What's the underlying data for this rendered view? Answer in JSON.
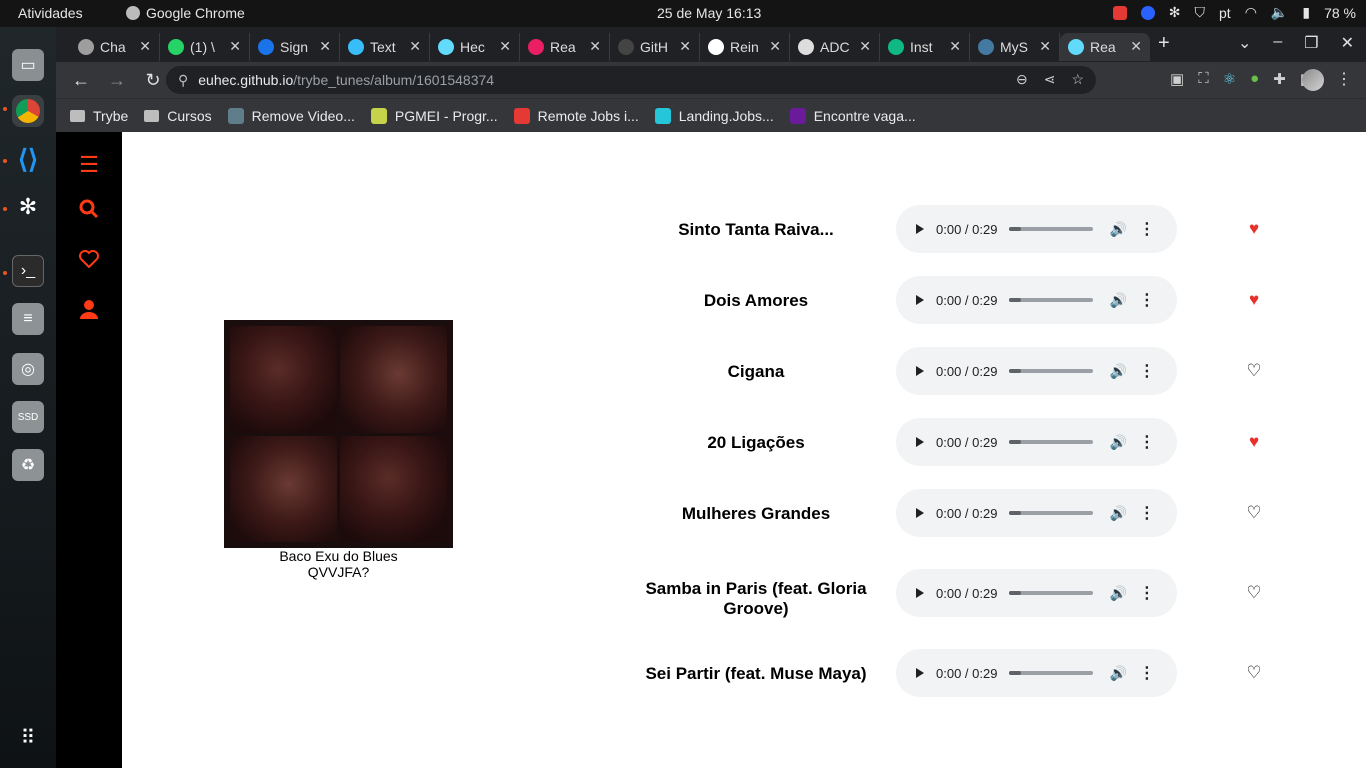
{
  "system": {
    "activities": "Atividades",
    "app_name": "Google Chrome",
    "datetime": "25 de May  16:13",
    "lang": "pt",
    "battery": "78 %"
  },
  "tabs": [
    {
      "title": "Cha",
      "color": "#9e9e9e"
    },
    {
      "title": "(1) \\",
      "color": "#25d366"
    },
    {
      "title": "Sign",
      "color": "#1a73e8"
    },
    {
      "title": "Text",
      "color": "#38bdf8"
    },
    {
      "title": "Hec",
      "color": "#61dafb"
    },
    {
      "title": "Rea",
      "color": "#e91e63"
    },
    {
      "title": "GitH",
      "color": "#444444"
    },
    {
      "title": "Rein",
      "color": "#ffffff"
    },
    {
      "title": "ADC",
      "color": "#dddddd"
    },
    {
      "title": "Inst",
      "color": "#10b981"
    },
    {
      "title": "MyS",
      "color": "#4479a1"
    },
    {
      "title": "Rea",
      "color": "#61dafb",
      "active": true
    }
  ],
  "url": {
    "host": "euhec.github.io",
    "path": "/trybe_tunes/album/1601548374"
  },
  "bookmarks": [
    {
      "label": "Trybe",
      "type": "folder"
    },
    {
      "label": "Cursos",
      "type": "folder"
    },
    {
      "label": "Remove Video...",
      "type": "icon",
      "color": "#607d8b"
    },
    {
      "label": "PGMEI - Progr...",
      "type": "icon",
      "color": "#c6d34a"
    },
    {
      "label": "Remote Jobs i...",
      "type": "icon",
      "color": "#e53935"
    },
    {
      "label": "Landing.Jobs...",
      "type": "icon",
      "color": "#26c6da"
    },
    {
      "label": "Encontre vaga...",
      "type": "icon",
      "color": "#6a1b9a"
    }
  ],
  "album": {
    "artist": "Baco Exu do Blues",
    "name": "QVVJFA?"
  },
  "tracks": [
    {
      "name": "Sinto Tanta Raiva...",
      "time": "0:00 / 0:29",
      "favorite": true
    },
    {
      "name": "Dois Amores",
      "time": "0:00 / 0:29",
      "favorite": true
    },
    {
      "name": "Cigana",
      "time": "0:00 / 0:29",
      "favorite": false
    },
    {
      "name": "20 Ligações",
      "time": "0:00 / 0:29",
      "favorite": true
    },
    {
      "name": "Mulheres Grandes",
      "time": "0:00 / 0:29",
      "favorite": false
    },
    {
      "name": "Samba in Paris (feat. Gloria Groove)",
      "time": "0:00 / 0:29",
      "favorite": false
    },
    {
      "name": "Sei Partir (feat. Muse Maya)",
      "time": "0:00 / 0:29",
      "favorite": false
    }
  ]
}
